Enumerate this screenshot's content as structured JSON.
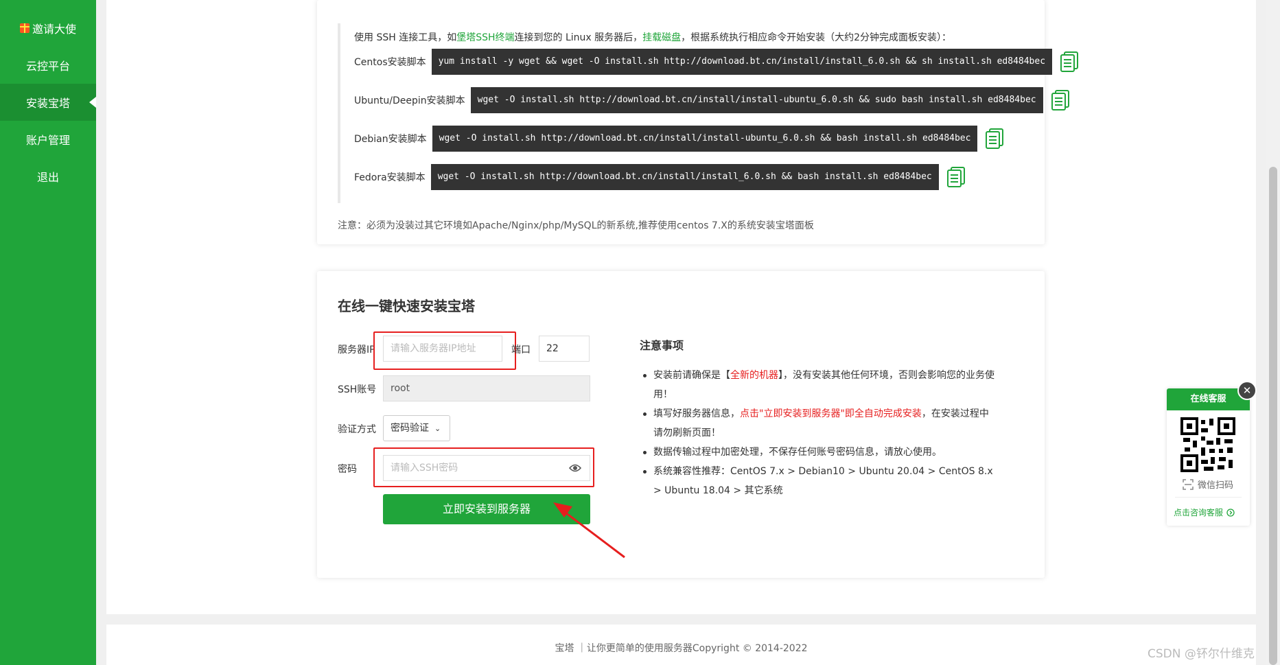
{
  "sidebar": {
    "items": [
      {
        "label": "邀请大使"
      },
      {
        "label": "云控平台"
      },
      {
        "label": "安装宝塔"
      },
      {
        "label": "账户管理"
      },
      {
        "label": "退出"
      }
    ],
    "active_index": 2
  },
  "ssh_intro": {
    "prefix": "使用 SSH 连接工具，如",
    "link1": "堡塔SSH终端",
    "middle": "连接到您的 Linux 服务器后，",
    "link2": "挂载磁盘",
    "suffix": "，根据系统执行相应命令开始安装（大约2分钟完成面板安装）："
  },
  "scripts": [
    {
      "label": "Centos安装脚本",
      "command": "yum install -y wget && wget -O install.sh http://download.bt.cn/install/install_6.0.sh && sh install.sh ed8484bec"
    },
    {
      "label": "Ubuntu/Deepin安装脚本",
      "command": "wget -O install.sh http://download.bt.cn/install/install-ubuntu_6.0.sh && sudo bash install.sh ed8484bec"
    },
    {
      "label": "Debian安装脚本",
      "command": "wget -O install.sh http://download.bt.cn/install/install-ubuntu_6.0.sh && bash install.sh ed8484bec"
    },
    {
      "label": "Fedora安装脚本",
      "command": "wget -O install.sh http://download.bt.cn/install/install_6.0.sh && bash install.sh ed8484bec"
    }
  ],
  "note": "注意：必须为没装过其它环境如Apache/Nginx/php/MySQL的新系统,推荐使用centos 7.X的系统安装宝塔面板",
  "install_form": {
    "title": "在线一键快速安装宝塔",
    "server_ip_label": "服务器IP",
    "server_ip_placeholder": "请输入服务器IP地址",
    "port_label": "端口",
    "port_value": "22",
    "ssh_account_label": "SSH账号",
    "ssh_account_value": "root",
    "auth_label": "验证方式",
    "auth_value": "密码验证",
    "password_label": "密码",
    "password_placeholder": "请输入SSH密码",
    "submit_label": "立即安装到服务器"
  },
  "notes": {
    "title": "注意事项",
    "item1_prefix": "安装前请确保是【",
    "item1_red": "全新的机器",
    "item1_suffix": "】，没有安装其他任何环境，否则会影响您的业务使用！",
    "item2_prefix": "填写好服务器信息，",
    "item2_red": "点击\"立即安装到服务器\"即全自动完成安装",
    "item2_suffix": "，在安装过程中请勿刷新页面！",
    "item3": "数据传输过程中加密处理，不保存任何账号密码信息，请放心使用。",
    "item4": "系统兼容性推荐：CentOS 7.x > Debian10 > Ubuntu 20.04 > CentOS 8.x > Ubuntu 18.04 > 其它系统"
  },
  "footer": "宝塔 ｜让你更简单的使用服务器Copyright © 2014-2022",
  "float_widget": {
    "title": "在线客服",
    "wechat_scan": "微信扫码",
    "consult": "点击咨询客服"
  },
  "watermark": "CSDN @钚尔什维克",
  "colors": {
    "brand_green": "#20a53a",
    "highlight_red": "#e61e1e"
  }
}
